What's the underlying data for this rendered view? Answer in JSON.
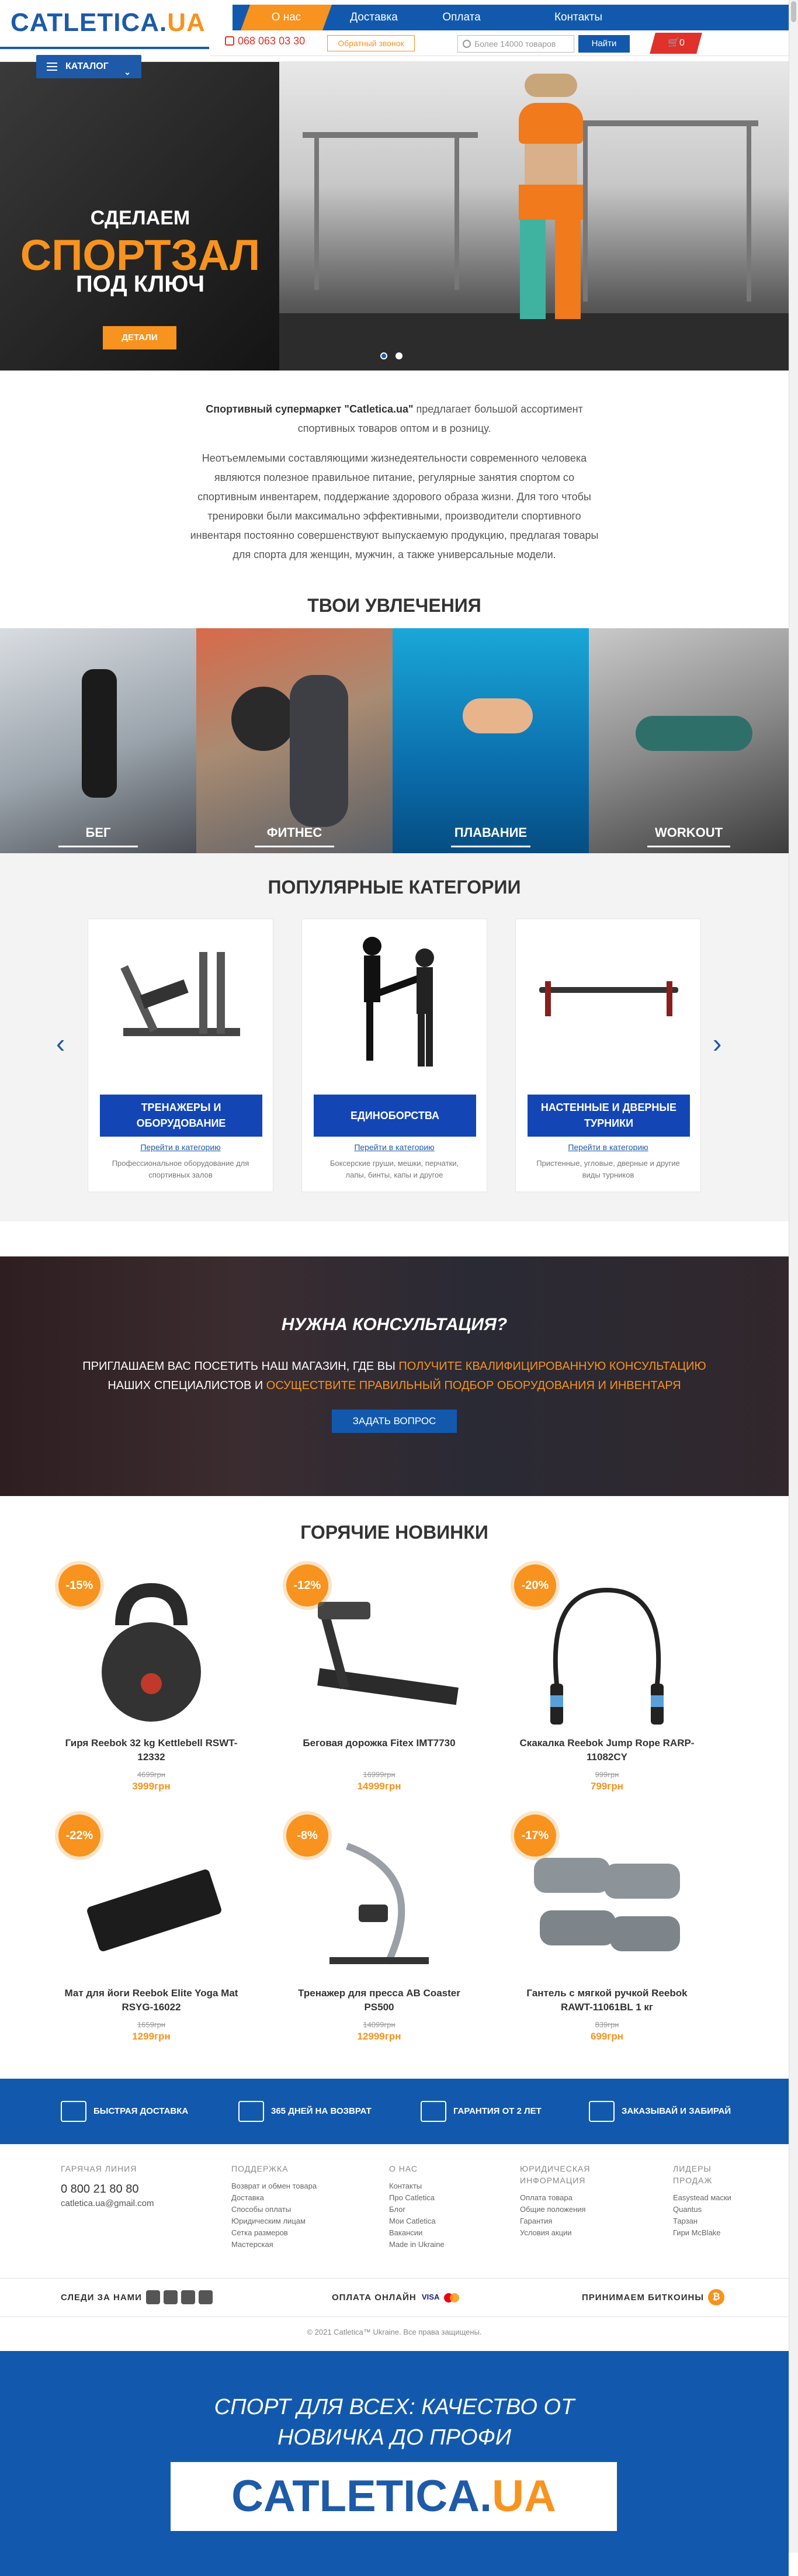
{
  "header": {
    "logo_main": "CATLETICA.",
    "logo_ua": "UA",
    "nav": [
      "О нас",
      "Доставка",
      "Оплата",
      "Контакты"
    ],
    "phone": "068 063 03 30",
    "callback": "Обратный звонок",
    "search_placeholder": "Более 14000 товаров",
    "search_button": "Найти",
    "cart_count": "0",
    "catalog": "КАТАЛОГ"
  },
  "hero": {
    "line1": "СДЕЛАЕМ",
    "line2": "СПОРТЗАЛ",
    "line3": "ПОД КЛЮЧ",
    "button": "ДЕТАЛИ"
  },
  "intro": {
    "brand": "Спортивный супермаркет \"Catletica.ua\"",
    "p1_rest": " предлагает большой ассортимент спортивных товаров оптом и в розницу.",
    "p2": "Неотъемлемыми составляющими жизнедеятельности современного человека являются полезное правильное питание, регулярные занятия спортом со спортивным инвентарем, поддержание здорового образа жизни. Для того чтобы тренировки были максимально эффективными, производители спортивного инвентаря постоянно совершенствуют выпускаемую продукцию, предлагая товары для спорта для женщин, мужчин, а также универсальные модели."
  },
  "hobbies": {
    "title": "ТВОИ УВЛЕЧЕНИЯ",
    "items": [
      "БЕГ",
      "ФИТНЕС",
      "ПЛАВАНИЕ",
      "WORKOUT"
    ]
  },
  "popular": {
    "title": "ПОПУЛЯРНЫЕ КАТЕГОРИИ",
    "cards": [
      {
        "title": "ТРЕНАЖЕРЫ И ОБОРУДОВАНИЕ",
        "link": "Перейти в категорию",
        "desc": "Профессиональное оборудование для спортивных залов"
      },
      {
        "title": "ЕДИНОБОРСТВА",
        "link": "Перейти в категорию",
        "desc": "Боксерские груши, мешки, перчатки, лапы, бинты, капы и другое"
      },
      {
        "title": "НАСТЕННЫЕ И ДВЕРНЫЕ ТУРНИКИ",
        "link": "Перейти в категорию",
        "desc": "Пристенные, угловые, дверные и другие виды турников"
      }
    ]
  },
  "consult": {
    "title": "НУЖНА КОНСУЛЬТАЦИЯ?",
    "t1": "ПРИГЛАШАЕМ ВАС ПОСЕТИТЬ НАШ МАГАЗИН, ГДЕ ВЫ ",
    "h1": "ПОЛУЧИТЕ КВАЛИФИЦИРОВАННУЮ КОНСУЛЬТАЦИЮ",
    "t2": " НАШИХ СПЕЦИАЛИСТОВ И ",
    "h2": "ОСУЩЕСТВИТЕ ПРАВИЛЬНЫЙ ПОДБОР ОБОРУДОВАНИЯ И ИНВЕНТАРЯ",
    "button": "ЗАДАТЬ ВОПРОС"
  },
  "hot": {
    "title": "ГОРЯЧИЕ НОВИНКИ",
    "products": [
      {
        "badge": "-15%",
        "name": "Гиря Reebok 32 kg Kettlebell RSWT-12332",
        "old": "4699грн",
        "price": "3999грн"
      },
      {
        "badge": "-12%",
        "name": "Беговая дорожка Fitex IMT7730",
        "old": "16999грн",
        "price": "14999грн"
      },
      {
        "badge": "-20%",
        "name": "Скакалка Reebok Jump Rope RARP-11082CY",
        "old": "999грн",
        "price": "799грн"
      },
      {
        "badge": "-22%",
        "name": "Мат для йоги Reebok Elite Yoga Mat RSYG-16022",
        "old": "1659грн",
        "price": "1299грн"
      },
      {
        "badge": "-8%",
        "name": "Тренажер для пресса AB Coaster PS500",
        "old": "14099грн",
        "price": "12999грн"
      },
      {
        "badge": "-17%",
        "name": "Гантель с мягкой ручкой Reebok RAWT-11061BL 1 кг",
        "old": "839грн",
        "price": "699грн"
      }
    ]
  },
  "benefits": [
    "БЫСТРАЯ ДОСТАВКА",
    "365 ДНЕЙ НА ВОЗВРАТ",
    "ГАРАНТИЯ ОТ 2 ЛЕТ",
    "ЗАКАЗЫВАЙ И ЗАБИРАЙ"
  ],
  "footer": {
    "hotline_title": "ГАРЯЧАЯ ЛИНИЯ",
    "hotline_phone": "0 800 21 80 80",
    "email": "catletica.ua@gmail.com",
    "support_title": "ПОДДЕРЖКА",
    "support": [
      "Возврат и обмен товара",
      "Доставка",
      "Способы оплаты",
      "Юридическим лицам",
      "Сетка размеров",
      "Мастерская"
    ],
    "about_title": "О НАС",
    "about": [
      "Контакты",
      "Про Catletica",
      "Блог",
      "Мои Catletica",
      "Вакансии",
      "Made in Ukraine"
    ],
    "legal_title_1": "ЮРИДИЧЕСКАЯ",
    "legal_title_2": "ИНФОРМАЦИЯ",
    "legal": [
      "Оплата товара",
      "Общие положения",
      "Гарантия",
      "Условия акции"
    ],
    "leaders_title_1": "ЛИДЕРЫ",
    "leaders_title_2": "ПРОДАЖ",
    "leaders": [
      "Easystead маски",
      "Quantus",
      "Тарзан",
      "Гири McBlake"
    ],
    "follow": "СЛЕДИ ЗА НАМИ",
    "pay": "ОПЛАТА ОНЛАЙН",
    "visa": "VISA",
    "bitcoin": "ПРИНИМАЕМ БИТКОИНЫ",
    "copyright": "© 2021 Catletica™ Ukraine. Все права защищены."
  },
  "banner": {
    "slogan1": "СПОРТ ДЛЯ ВСЕХ: КАЧЕСТВО ОТ",
    "slogan2": "НОВИЧКА ДО ПРОФИ",
    "logo_main": "CATLETICA.",
    "logo_ua": "UA"
  },
  "colors": {
    "brand_blue": "#1259ad",
    "accent_orange": "#f7931e",
    "cart_red": "#e0312b"
  }
}
